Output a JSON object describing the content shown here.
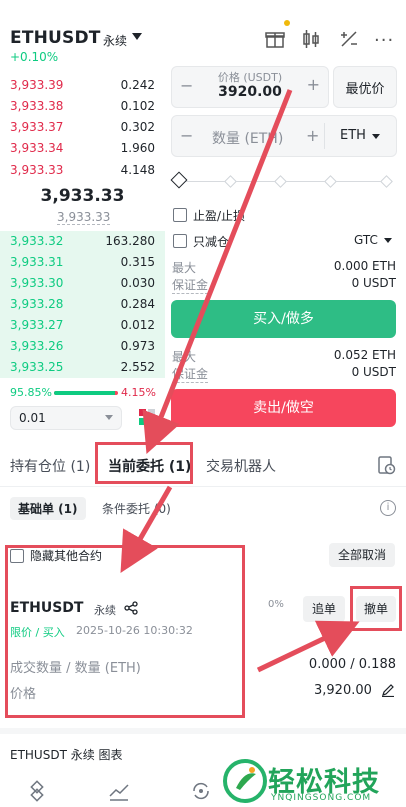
{
  "header": {
    "symbol": "ETHUSDT",
    "contract_type": "永续",
    "change": "+0.10%"
  },
  "orderbook": {
    "asks": [
      {
        "price": "3,933.39",
        "qty": "0.242"
      },
      {
        "price": "3,933.38",
        "qty": "0.102"
      },
      {
        "price": "3,933.37",
        "qty": "0.302"
      },
      {
        "price": "3,933.34",
        "qty": "1.960"
      },
      {
        "price": "3,933.33",
        "qty": "4.148"
      }
    ],
    "last_price": "3,933.33",
    "mark_price": "3,933.33",
    "bids": [
      {
        "price": "3,933.32",
        "qty": "163.280"
      },
      {
        "price": "3,933.31",
        "qty": "0.315"
      },
      {
        "price": "3,933.30",
        "qty": "0.030"
      },
      {
        "price": "3,933.28",
        "qty": "0.284"
      },
      {
        "price": "3,933.27",
        "qty": "0.012"
      },
      {
        "price": "3,933.26",
        "qty": "0.973"
      },
      {
        "price": "3,933.25",
        "qty": "2.552"
      }
    ],
    "buy_ratio": "95.85%",
    "sell_ratio": "4.15%",
    "buy_ratio_value": 95.85,
    "precision": "0.01"
  },
  "order_form": {
    "price_label": "价格 (USDT)",
    "price_value": "3920.00",
    "best_price_label": "最优价",
    "qty_placeholder": "数量 (ETH)",
    "qty_unit": "ETH",
    "tp_sl_label": "止盈/止损",
    "reduce_only_label": "只减仓",
    "tif": "GTC",
    "buy_max_label": "最大",
    "buy_max_value": "0.000 ETH",
    "buy_margin_label": "保证金",
    "buy_margin_value": "0 USDT",
    "buy_button": "买入/做多",
    "sell_max_label": "最大",
    "sell_max_value": "0.052 ETH",
    "sell_margin_label": "保证金",
    "sell_margin_value": "0 USDT",
    "sell_button": "卖出/做空"
  },
  "tabs": {
    "positions": "持有仓位 (1)",
    "open_orders": "当前委托 (1)",
    "bots": "交易机器人"
  },
  "subtabs": {
    "basic": "基础单 (1)",
    "conditional": "条件委托 (0)"
  },
  "orders_toolbar": {
    "hide_other": "隐藏其他合约",
    "cancel_all": "全部取消"
  },
  "order": {
    "symbol": "ETHUSDT",
    "contract_type": "永续",
    "type": "限价 / 买入",
    "time": "2025-10-26 10:30:32",
    "progress": "0%",
    "modify_button": "追单",
    "cancel_button": "撤单",
    "filled_label": "成交数量 / 数量 (ETH)",
    "filled_value": "0.000 / 0.188",
    "price_label": "价格",
    "price_value": "3,920.00"
  },
  "footer": {
    "chart_title": "ETHUSDT 永续 图表"
  },
  "watermark": {
    "brand": "轻松科技",
    "url": "YNQINGSONG.COM"
  }
}
